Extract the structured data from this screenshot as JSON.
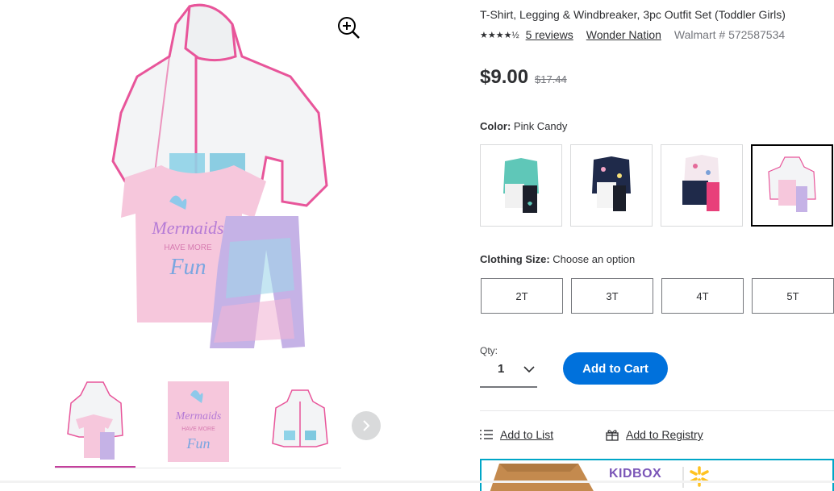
{
  "product": {
    "title": "T-Shirt, Legging & Windbreaker, 3pc Outfit Set (Toddler Girls)",
    "rating_stars": "★★★★½",
    "reviews_link": "5 reviews",
    "brand_link": "Wonder Nation",
    "sku": "Walmart # 572587534",
    "price": "$9.00",
    "was_price": "$17.44"
  },
  "color": {
    "label": "Color:",
    "value": "Pink Candy",
    "selected_index": 3
  },
  "size": {
    "label": "Clothing Size:",
    "value": "Choose an option",
    "options": [
      "2T",
      "3T",
      "4T",
      "5T"
    ]
  },
  "quantity": {
    "label": "Qty:",
    "value": "1"
  },
  "actions": {
    "add_to_cart": "Add to Cart",
    "add_to_list": "Add to List",
    "add_to_registry": "Add to Registry"
  },
  "banner": {
    "brand": "KIDBOX"
  },
  "shirt_text": {
    "line1": "Mermaids",
    "line2": "HAVE MORE",
    "line3": "Fun"
  },
  "colors": {
    "accent": "#0071dc",
    "thumb_selected": "#c43f9c",
    "jacket_trim": "#e8559a",
    "shirt": "#f6c7dc"
  }
}
